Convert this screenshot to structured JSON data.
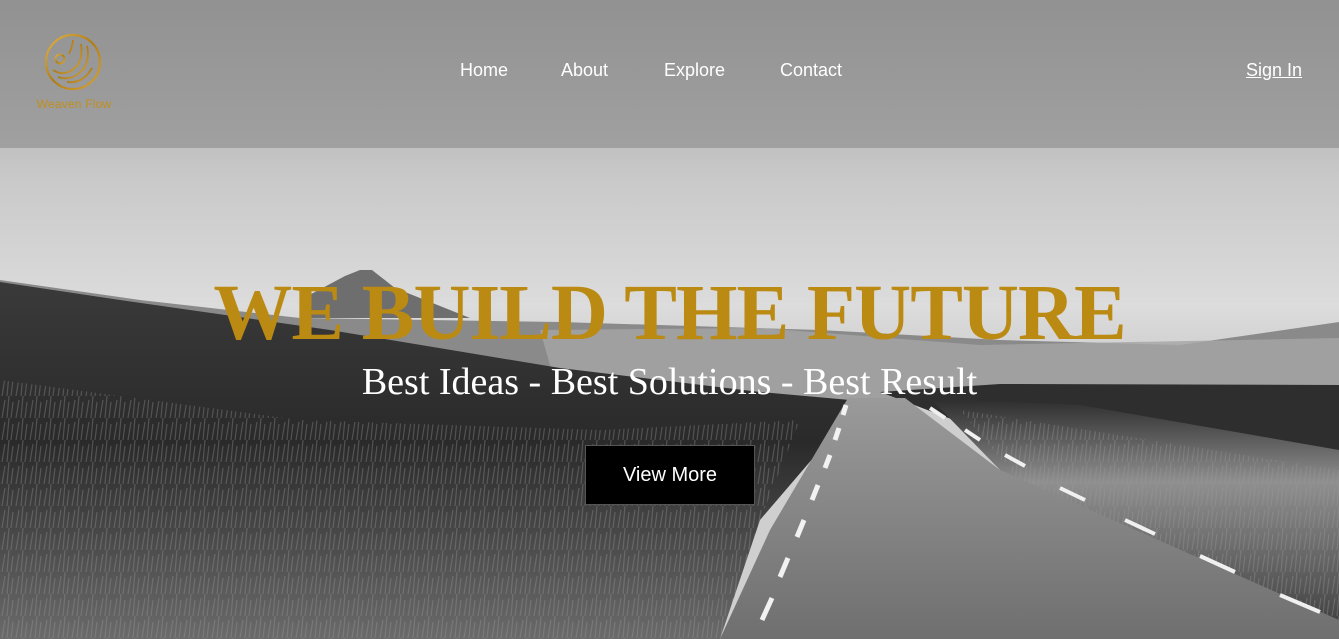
{
  "brand": {
    "name": "Weaven Flow",
    "logo_icon": "weaven-flow-logo",
    "color": "#c08f1c"
  },
  "nav": {
    "items": [
      {
        "label": "Home"
      },
      {
        "label": "About"
      },
      {
        "label": "Explore"
      },
      {
        "label": "Contact"
      }
    ],
    "signin_label": "Sign In"
  },
  "hero": {
    "title": "WE BUILD THE FUTURE",
    "subtitle": "Best Ideas - Best Solutions - Best Result",
    "cta_label": "View More",
    "title_color": "#bb8a12",
    "background": "grayscale landscape photo of a road through grassy hills"
  }
}
